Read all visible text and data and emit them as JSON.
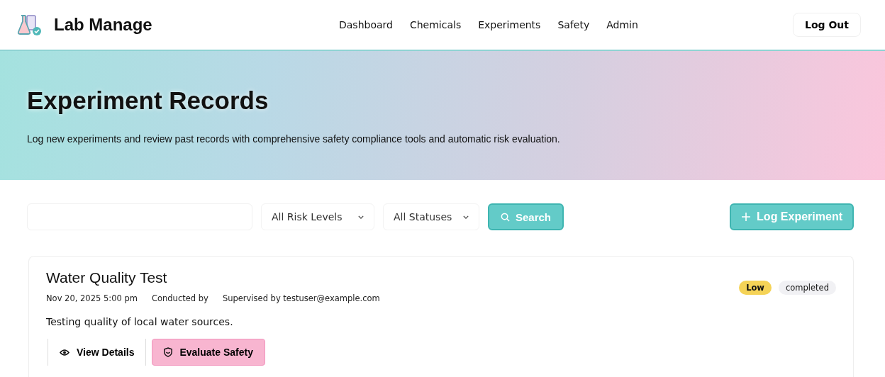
{
  "brand": {
    "name": "Lab Manage"
  },
  "nav": [
    "Dashboard",
    "Chemicals",
    "Experiments",
    "Safety",
    "Admin"
  ],
  "logout": "Log Out",
  "hero": {
    "title": "Experiment Records",
    "subtitle": "Log new experiments and review past records with comprehensive safety compliance tools and automatic risk evaluation."
  },
  "filters": {
    "risk": "All Risk Levels",
    "status": "All Statuses",
    "search_button": "Search",
    "log_button": "Log Experiment"
  },
  "records": [
    {
      "title": "Water Quality Test",
      "date": "Nov 20, 2025 5:00 pm",
      "conducted": "Conducted by",
      "supervised": "Supervised by testuser@example.com",
      "risk": "Low",
      "status": "completed",
      "description": "Testing quality of local water sources.",
      "actions": [
        "View Details",
        "Evaluate Safety"
      ]
    }
  ]
}
